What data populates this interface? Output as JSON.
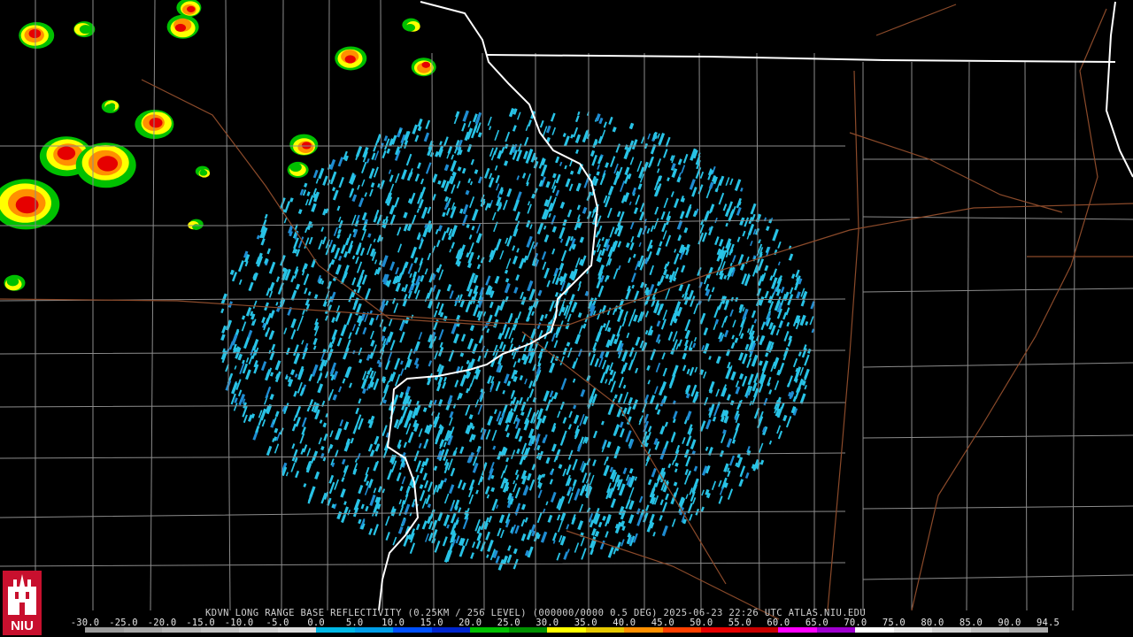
{
  "product": {
    "caption": "KDVN LONG RANGE BASE REFLECTIVITY (0.25KM / 256 LEVEL) (000000/0000 0.5 DEG) 2025-06-23 22:26 UTC  ATLAS.NIU.EDU"
  },
  "logo": {
    "text": "NIU",
    "icon": "niu-tower-logo-icon",
    "color": "#c8102e"
  },
  "colorscale": {
    "labels": [
      "-30.0",
      "-25.0",
      "-20.0",
      "-15.0",
      "-10.0",
      "-5.0",
      "0.0",
      "5.0",
      "10.0",
      "15.0",
      "20.0",
      "25.0",
      "30.0",
      "35.0",
      "40.0",
      "45.0",
      "50.0",
      "55.0",
      "60.0",
      "65.0",
      "70.0",
      "75.0",
      "80.0",
      "85.0",
      "90.0",
      "94.5"
    ],
    "colors": [
      "#9a9a9a",
      "#a6a6a6",
      "#b4b4b4",
      "#c2c2c2",
      "#d0d0d0",
      "#dcdcdc",
      "#00b8e6",
      "#009ee8",
      "#0050ff",
      "#0026d0",
      "#00c000",
      "#009000",
      "#ffff00",
      "#e6c800",
      "#ff9000",
      "#ff4000",
      "#e60000",
      "#c80000",
      "#ff00ff",
      "#a000d0",
      "#ffffff",
      "#e6e6e6",
      "#d2d2d2",
      "#bebebe",
      "#aaaaaa"
    ]
  },
  "map_colors": {
    "background": "#000000",
    "state_border": "#ffffff",
    "county_border": "#8c8c8c",
    "highway": "#8b4a2a",
    "clutter": "#28c3e6",
    "clutter_dark": "#1f8cd2"
  },
  "radar_site": "KDVN"
}
